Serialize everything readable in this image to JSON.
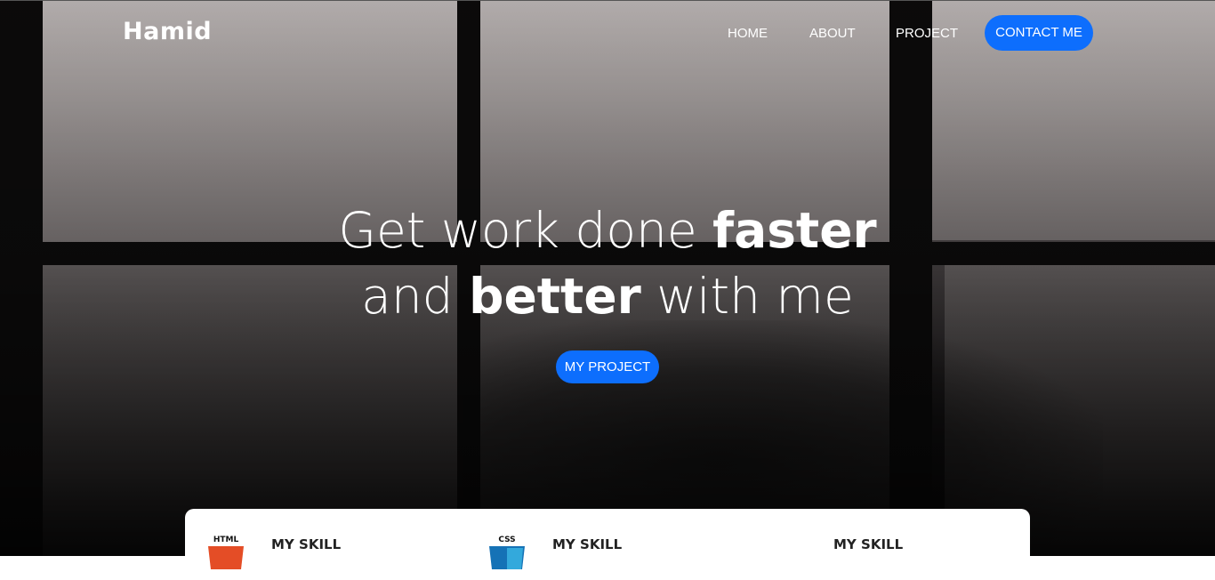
{
  "brand": "Hamid",
  "nav": {
    "items": [
      "HOME",
      "ABOUT",
      "PROJECT"
    ],
    "contact_label": "CONTACT ME"
  },
  "hero": {
    "line1_light": "Get work done ",
    "line1_bold": "faster",
    "line2_light_a": "and ",
    "line2_bold": "better",
    "line2_light_b": " with me",
    "cta_label": "MY PROJECT"
  },
  "skills": [
    {
      "icon_text": "HTML",
      "icon": "html5-icon",
      "title": "MY SKILL"
    },
    {
      "icon_text": "CSS",
      "icon": "css3-icon",
      "title": "MY SKILL"
    },
    {
      "icon": "js-icon",
      "title": "MY SKILL"
    }
  ],
  "colors": {
    "accent": "#0d6efd",
    "html_orange": "#e44d26",
    "css_blue": "#1572b6"
  }
}
